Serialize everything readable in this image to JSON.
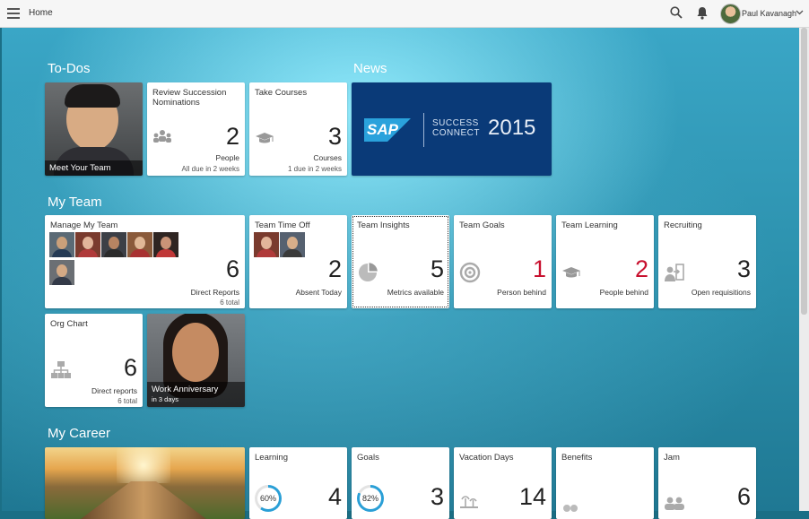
{
  "topbar": {
    "home_label": "Home",
    "user_name": "Paul Kavanagh",
    "icons": [
      "menu-icon",
      "search-icon",
      "bell-icon",
      "chevron-down-icon"
    ]
  },
  "sections": {
    "todos": "To-Dos",
    "news": "News",
    "my_team": "My Team",
    "my_career": "My Career"
  },
  "todos": {
    "meet_team": {
      "caption": "Meet Your Team"
    },
    "succession": {
      "title": "Review Succession Nominations",
      "value": "2",
      "unit": "People",
      "foot": "All due in 2 weeks",
      "icon": "people-icon"
    },
    "courses": {
      "title": "Take Courses",
      "value": "3",
      "unit": "Courses",
      "foot": "1 due in 2 weeks",
      "icon": "graduation-cap-icon"
    }
  },
  "news": {
    "logo": "SAP",
    "line1": "SUCCESS",
    "line2": "CONNECT",
    "year": "2015",
    "brand_color": "#0a3a78"
  },
  "team": {
    "manage": {
      "title": "Manage My Team",
      "value": "6",
      "unit": "Direct Reports",
      "foot": "6 total"
    },
    "timeoff": {
      "title": "Team Time Off",
      "value": "2",
      "unit": "Absent Today"
    },
    "insights": {
      "title": "Team Insights",
      "value": "5",
      "unit": "Metrics available",
      "icon": "pie-chart-icon"
    },
    "goals": {
      "title": "Team Goals",
      "value": "1",
      "unit": "Person behind",
      "icon": "target-icon"
    },
    "learning": {
      "title": "Team Learning",
      "value": "2",
      "unit": "People behind",
      "icon": "graduation-cap-icon"
    },
    "recruiting": {
      "title": "Recruiting",
      "value": "3",
      "unit": "Open requisitions",
      "icon": "person-entry-icon"
    },
    "orgchart": {
      "title": "Org Chart",
      "value": "6",
      "unit": "Direct reports",
      "foot": "6 total",
      "icon": "org-chart-icon"
    },
    "anniversary": {
      "caption": "Work Anniversary",
      "sub": "in 3 days"
    }
  },
  "career": {
    "learning": {
      "title": "Learning",
      "percent_label": "60%",
      "percent": 60,
      "value": "4"
    },
    "goals": {
      "title": "Goals",
      "percent_label": "82%",
      "percent": 82,
      "value": "3"
    },
    "vacation": {
      "title": "Vacation Days",
      "value": "14",
      "icon": "beach-icon"
    },
    "benefits": {
      "title": "Benefits",
      "icon": "benefits-icon"
    },
    "jam": {
      "title": "Jam",
      "value": "6",
      "icon": "people-icon"
    }
  },
  "colors": {
    "accent_red": "#c8102e",
    "ring": "#2a9fd6",
    "tile_bg": "#ffffff"
  }
}
